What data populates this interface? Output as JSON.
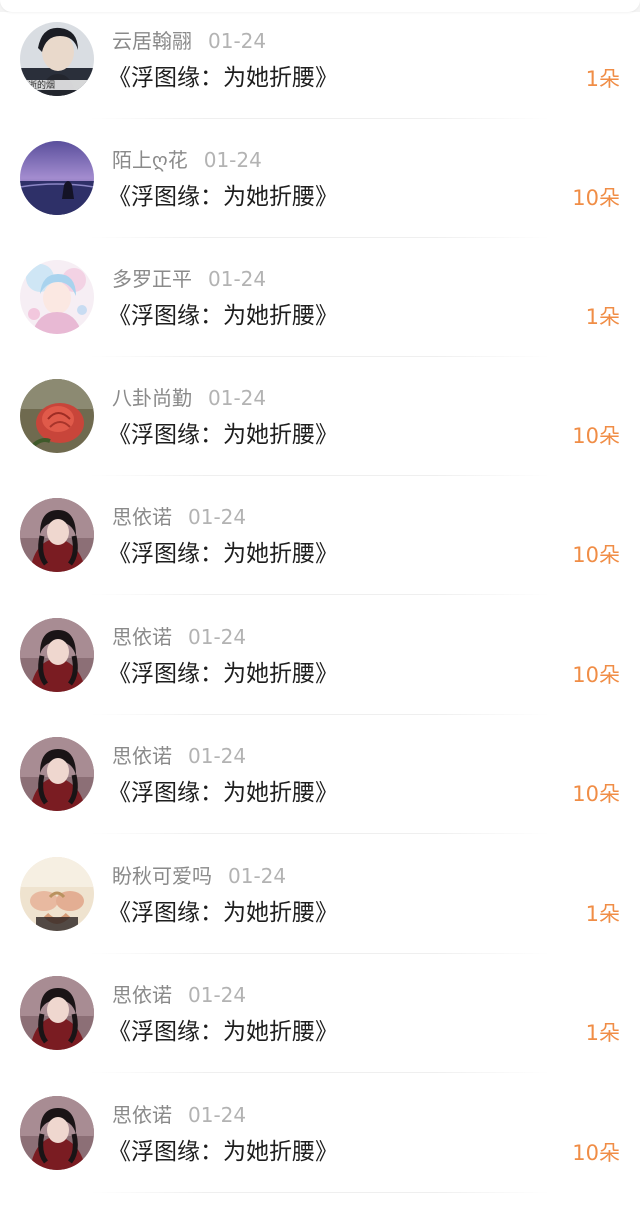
{
  "colors": {
    "name_text": "#8a8a8a",
    "date_text": "#b3b3b3",
    "title_text": "#1e1e1e",
    "amount_text": "#f08d46",
    "background": "#ffffff"
  },
  "gifts": [
    {
      "user": "云居翰翮",
      "date": "01-24",
      "title": "《浮图缘：为她折腰》",
      "amount": "1朵",
      "avatar": "boy-portrait-avatar"
    },
    {
      "user": "陌上ღ花",
      "date": "01-24",
      "title": "《浮图缘：为她折腰》",
      "amount": "10朵",
      "avatar": "purple-sea-avatar"
    },
    {
      "user": "多罗正平",
      "date": "01-24",
      "title": "《浮图缘：为她折腰》",
      "amount": "1朵",
      "avatar": "anime-girl-avatar"
    },
    {
      "user": "八卦尚勤",
      "date": "01-24",
      "title": "《浮图缘：为她折腰》",
      "amount": "10朵",
      "avatar": "red-rose-avatar"
    },
    {
      "user": "思依诺",
      "date": "01-24",
      "title": "《浮图缘：为她折腰》",
      "amount": "10朵",
      "avatar": "woman-portrait-avatar"
    },
    {
      "user": "思依诺",
      "date": "01-24",
      "title": "《浮图缘：为她折腰》",
      "amount": "10朵",
      "avatar": "woman-portrait-avatar"
    },
    {
      "user": "思依诺",
      "date": "01-24",
      "title": "《浮图缘：为她折腰》",
      "amount": "10朵",
      "avatar": "woman-portrait-avatar"
    },
    {
      "user": "盼秋可爱吗",
      "date": "01-24",
      "title": "《浮图缘：为她折腰》",
      "amount": "1朵",
      "avatar": "hands-ring-avatar"
    },
    {
      "user": "思依诺",
      "date": "01-24",
      "title": "《浮图缘：为她折腰》",
      "amount": "1朵",
      "avatar": "woman-portrait-avatar"
    },
    {
      "user": "思依诺",
      "date": "01-24",
      "title": "《浮图缘：为她折腰》",
      "amount": "10朵",
      "avatar": "woman-portrait-avatar"
    }
  ]
}
